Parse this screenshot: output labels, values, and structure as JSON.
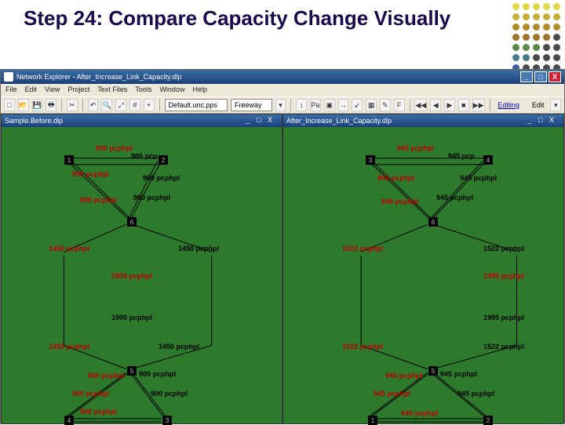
{
  "slide": {
    "title": "Step 24: Compare Capacity Change Visually"
  },
  "dotColors": [
    [
      "#e0d84a",
      "#e0d84a",
      "#e0d84a",
      "#e0d84a",
      "#e0d84a"
    ],
    [
      "#c7b03a",
      "#c7b03a",
      "#c7b03a",
      "#c7b03a",
      "#c7b03a"
    ],
    [
      "#b28a2a",
      "#b28a2a",
      "#b28a2a",
      "#b28a2a",
      "#b28a2a"
    ],
    [
      "#a0732a",
      "#a0732a",
      "#a0732a",
      "#a0732a",
      "#4a4a4a"
    ],
    [
      "#5a8a4a",
      "#5a8a4a",
      "#5a8a4a",
      "#4a4a4a",
      "#4a4a4a"
    ],
    [
      "#4a7a8a",
      "#4a7a8a",
      "#4a4a4a",
      "#4a4a4a",
      "#4a4a4a"
    ],
    [
      "#3a5a9a",
      "#4a4a4a",
      "#4a4a4a",
      "#4a4a4a",
      "#4a4a4a"
    ]
  ],
  "app": {
    "title": "Network Explorer - After_Increase_Link_Capacity.dlp",
    "menu": [
      "File",
      "Edit",
      "View",
      "Project",
      "Text Files",
      "Tools",
      "Window",
      "Help"
    ],
    "winControls": {
      "min": "_",
      "max": "□",
      "close": "X"
    },
    "toolbar": {
      "newIcon": "□",
      "openIcon": "📂",
      "saveIcon": "💾",
      "printIcon": "🖶",
      "cutIcon": "✂",
      "undoIcon": "↶",
      "zoomIcon": "🔍",
      "fitIcon": "⤢",
      "gridIcon": "#",
      "plusIcon": "+",
      "selectLabelA": "Default.unc.pps",
      "selectLabelB": "Freeway",
      "rightBtn1": "↕",
      "rightBtn2": "Pa",
      "rightBtn3": "▣",
      "rightBtn4": "→",
      "rightBtn5": "↙",
      "rightBtn6": "▦",
      "rightBtn7": "✎",
      "rightBtn8": "F",
      "play1": "◀◀",
      "play2": "◀",
      "play3": "▶",
      "play4": "■",
      "play5": "▶▶",
      "editLink": "Editing",
      "editLabel": "Edit",
      "dropdownIcon": "▾"
    }
  },
  "left": {
    "title": "Sample.Before.dlp",
    "nodes": {
      "n1": "1",
      "n2": "2",
      "n3": "3",
      "n4": "4",
      "n5": "5",
      "n6": "6"
    },
    "labels": {
      "t_900a": "900 pcphpl",
      "t_900b": "900 pcp",
      "t_900c": "900 pcphpl",
      "t_900d": "900 pcphpl",
      "t_900e": "900 pcphpl",
      "t_900f": "900 pcphpl",
      "t_900g": "900 pcphpl",
      "t_900h": "900 pcphpl",
      "t_900i": "900 pcphpl",
      "t_900j": "900 pcphpl",
      "t_900k": "900 pcphpl",
      "t_1450a": "1450 pcphpl",
      "t_1450b": "1450 pcphpl",
      "t_1450c": "1450 pcphpl",
      "t_1450d": "1450 pcphpl",
      "t_1900a": "1900 pcphpl",
      "t_1900b": "1900 pcphpl"
    }
  },
  "right": {
    "title": "After_Increase_Link_Capacity.dlp",
    "nodes": {
      "n1": "1",
      "n2": "2",
      "n3": "3",
      "n4": "4",
      "n5": "5",
      "n6": "6"
    },
    "labels": {
      "t_945a": "945 pcphpl",
      "t_945b": "945 pcp",
      "t_945c": "945 pcphpl",
      "t_945d": "945 pcphpl",
      "t_945e": "945 pcphpl",
      "t_945f": "945 pcphpl",
      "t_945g": "945 pcphpl",
      "t_945h": "945 pcphpl",
      "t_945i": "945 pcphpl",
      "t_945j": "945 pcphpl",
      "t_945k": "945 pcphpl",
      "t_1522a": "1522 pcphpl",
      "t_1522b": "1522 pcphpl",
      "t_1522c": "1522 pcphpl",
      "t_1522d": "1522 pcphpl",
      "t_1995a": "1995 pcphpl",
      "t_1995b": "1995 pcphpl"
    }
  }
}
